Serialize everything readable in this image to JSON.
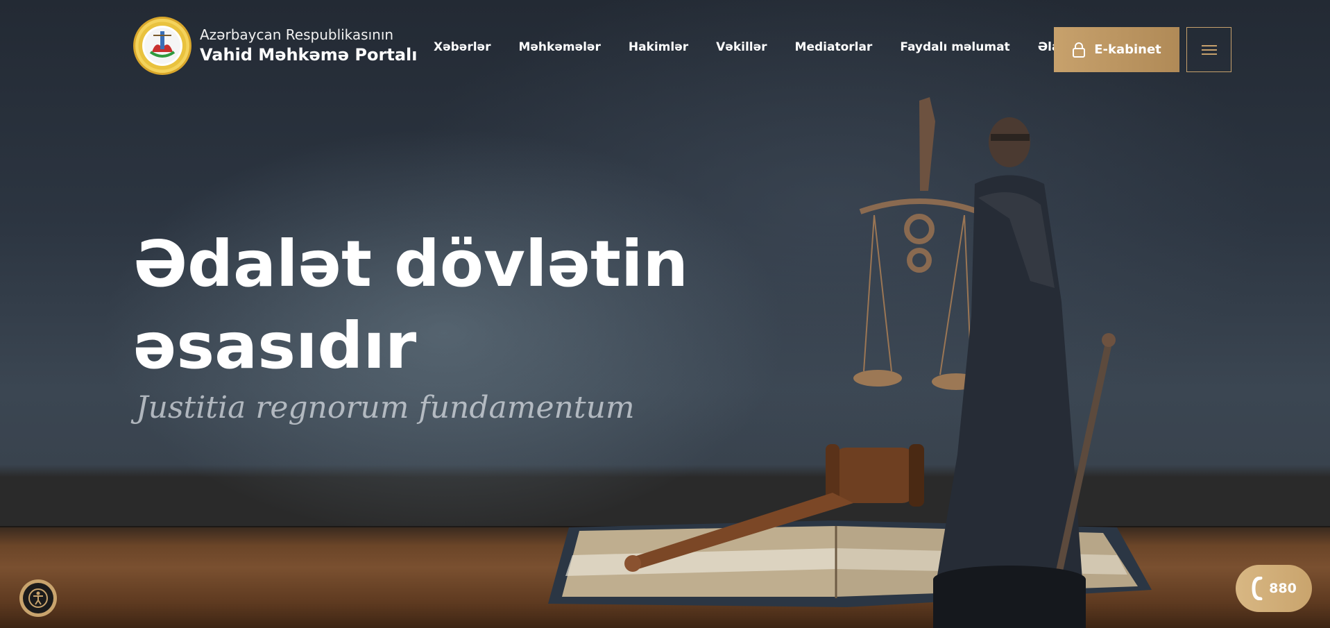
{
  "brand": {
    "line1": "Azərbaycan Respublikasının",
    "line2": "Vahid Məhkəmə Portalı",
    "logo_icon": "court-emblem-icon"
  },
  "nav": {
    "items": [
      {
        "label": "Xəbərlər"
      },
      {
        "label": "Məhkəmələr"
      },
      {
        "label": "Hakimlər"
      },
      {
        "label": "Vəkillər"
      },
      {
        "label": "Mediatorlar"
      },
      {
        "label": "Faydalı məlumat"
      },
      {
        "label": "Əlaqə"
      }
    ]
  },
  "header": {
    "ecabinet_label": "E-kabinet",
    "ecabinet_icon": "lock-icon",
    "menu_icon": "hamburger-menu-icon"
  },
  "hero": {
    "title_line1": "Ədalət dövlətin",
    "title_line2": "əsasıdır",
    "motto": "Justitia regnorum fundamentum"
  },
  "floating": {
    "accessibility_icon": "accessibility-icon",
    "hotline_number": "880",
    "hotline_icon": "phone-icon"
  },
  "colors": {
    "accent_gold": "#c7a16c",
    "background_dark": "#2a313c"
  }
}
